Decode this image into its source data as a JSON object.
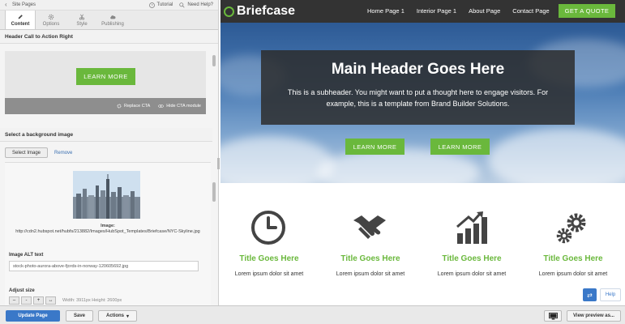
{
  "topbar": {
    "crumb": "Site Pages",
    "tutorial": "Tutorial",
    "help": "Need Help?"
  },
  "tabs": [
    {
      "label": "Content",
      "icon": "pencil-icon"
    },
    {
      "label": "Options",
      "icon": "gear-icon"
    },
    {
      "label": "Style",
      "icon": "scissors-icon"
    },
    {
      "label": "Publishing",
      "icon": "cloud-icon"
    }
  ],
  "cta_module": {
    "heading": "Header Call to Action Right",
    "button_label": "LEARN MORE",
    "replace_label": "Replace CTA",
    "hide_label": "Hide CTA module"
  },
  "background": {
    "heading": "Select a background image",
    "select_label": "Select Image",
    "remove_label": "Remove",
    "image_label": "Image:",
    "image_url": "http://cdn2.hubspot.net/hubfs/213882/Images/HubSpot_Templates/Briefcase/NYC-Skyline.jpg",
    "alt_label": "Image ALT text",
    "alt_value": "stock-photo-aurora-above-fjords-in-norway-120605692.jpg",
    "size_label": "Adjust size",
    "size_buttons": [
      "–",
      "-",
      "+",
      "↔"
    ],
    "size_text": "Width: 3911px  Height: 2600px"
  },
  "bottombar": {
    "update_label": "Update Page",
    "save_label": "Save",
    "actions_label": "Actions",
    "preview_label": "View preview as..."
  },
  "site": {
    "logo": "Briefcase",
    "nav": [
      "Home Page 1",
      "Interior Page 1",
      "About Page",
      "Contact Page"
    ],
    "nav_cta": "GET A QUOTE",
    "hero_title": "Main Header Goes Here",
    "hero_sub": "This is a subheader. You might want to put a thought here to engage visitors. For example, this is a template from Brand Builder Solutions.",
    "hero_buttons": [
      "LEARN MORE",
      "LEARN MORE"
    ],
    "features": [
      {
        "icon": "clock-icon",
        "title": "Title Goes Here",
        "text": "Lorem ipsum dolor sit amet"
      },
      {
        "icon": "handshake-icon",
        "title": "Title Goes Here",
        "text": "Lorem ipsum dolor sit amet"
      },
      {
        "icon": "growth-chart-icon",
        "title": "Title Goes Here",
        "text": "Lorem ipsum dolor sit amet"
      },
      {
        "icon": "gears-icon",
        "title": "Title Goes Here",
        "text": "Lorem ipsum dolor sit amet"
      }
    ]
  },
  "help_widget": {
    "label": "Help"
  },
  "colors": {
    "accent_green": "#6ab83c",
    "nav_dark": "#333333",
    "primary_blue": "#3a78c8"
  }
}
